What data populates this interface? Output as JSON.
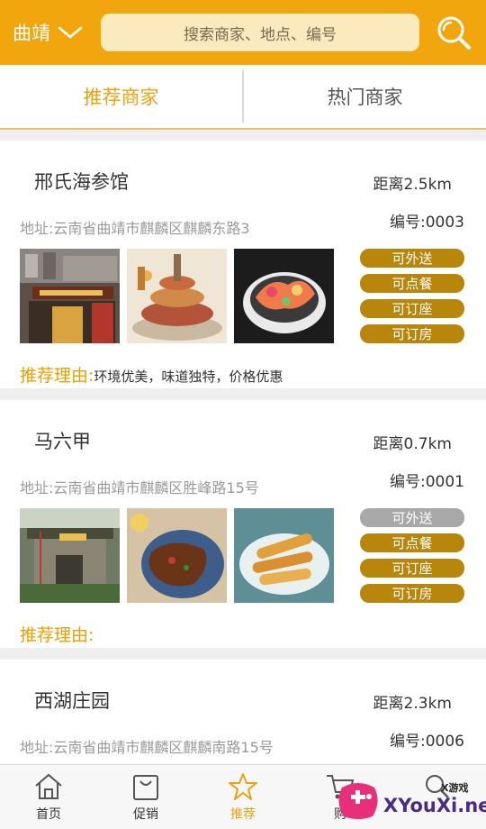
{
  "header": {
    "city": "曲靖",
    "search_placeholder": "搜索商家、地点、编号",
    "colors": {
      "brand": "#f2a60d",
      "accent": "#e8a000",
      "badge": "#b8860b"
    }
  },
  "tabs": [
    {
      "label": "推荐商家",
      "active": true
    },
    {
      "label": "热门商家",
      "active": false
    }
  ],
  "merchants": [
    {
      "name": "邢氏海参馆",
      "distance": "距离2.5km",
      "address": "地址:云南省曲靖市麒麟区麒麟东路3",
      "number": "编号:0003",
      "badges": [
        {
          "label": "可外送",
          "enabled": true
        },
        {
          "label": "可点餐",
          "enabled": true
        },
        {
          "label": "可订座",
          "enabled": true
        },
        {
          "label": "可订房",
          "enabled": true
        }
      ],
      "reason_label": "推荐理由:",
      "reason_text": "环境优美，味道独特，价格优惠",
      "photos": [
        "storefront-photo",
        "seafood-tower-photo",
        "sashimi-plate-photo"
      ]
    },
    {
      "name": "马六甲",
      "distance": "距离0.7km",
      "address": "地址:云南省曲靖市麒麟区胜峰路15号",
      "number": "编号:0001",
      "badges": [
        {
          "label": "可外送",
          "enabled": false
        },
        {
          "label": "可点餐",
          "enabled": true
        },
        {
          "label": "可订座",
          "enabled": true
        },
        {
          "label": "可订房",
          "enabled": true
        }
      ],
      "reason_label": "推荐理由:",
      "reason_text": "",
      "photos": [
        "storefront-photo",
        "grilled-meat-photo",
        "spring-rolls-photo"
      ]
    },
    {
      "name": "西湖庄园",
      "distance": "距离2.3km",
      "address": "地址:云南省曲靖市麒麟区麒麟南路15号",
      "number": "编号:0006",
      "badges": [],
      "reason_label": "",
      "reason_text": "",
      "photos": []
    }
  ],
  "bottom_nav": [
    {
      "label": "首页",
      "icon": "home-icon",
      "active": false
    },
    {
      "label": "促销",
      "icon": "shopping-bag-icon",
      "active": false
    },
    {
      "label": "推荐",
      "icon": "star-icon",
      "active": true
    },
    {
      "label": "购",
      "icon": "cart-icon",
      "active": false
    },
    {
      "label": "",
      "icon": "search-icon",
      "active": false
    }
  ],
  "watermark": {
    "text": "XYouXi.net",
    "small": "X游戏"
  }
}
